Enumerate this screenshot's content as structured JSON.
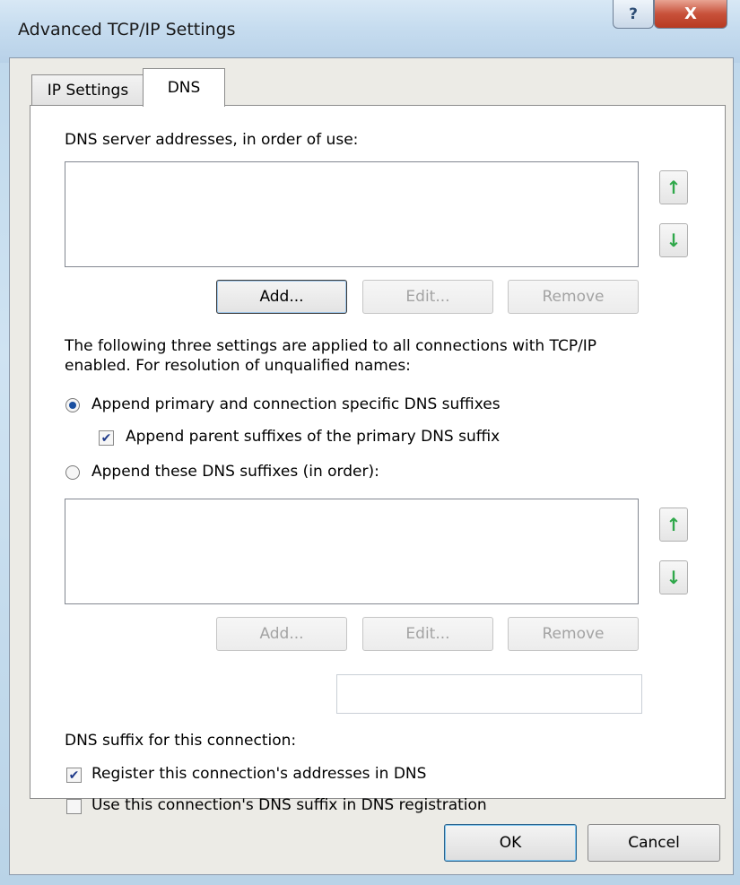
{
  "window": {
    "title": "Advanced TCP/IP Settings",
    "help_label": "?",
    "close_label": "X"
  },
  "tabs": [
    {
      "label": "IP Settings"
    },
    {
      "label": "DNS"
    }
  ],
  "dns_servers": {
    "label": "DNS server addresses, in order of use:",
    "items": [],
    "up_icon": "up-arrow-icon",
    "down_icon": "down-arrow-icon",
    "buttons": {
      "add": "Add...",
      "edit": "Edit...",
      "remove": "Remove"
    }
  },
  "info_text": {
    "line1": "The following three settings are applied to all connections with TCP/IP",
    "line2": "enabled. For resolution of unqualified names:"
  },
  "radio_primary": {
    "label": "Append primary and connection specific DNS suffixes",
    "checked": true
  },
  "check_parent": {
    "label": "Append parent suffixes of the primary DNS suffix",
    "checked": true
  },
  "radio_these": {
    "label": "Append these DNS suffixes (in order):",
    "checked": false
  },
  "dns_suffixes": {
    "items": [],
    "buttons": {
      "add": "Add...",
      "edit": "Edit...",
      "remove": "Remove"
    }
  },
  "suffix_field": {
    "label": "DNS suffix for this connection:",
    "value": ""
  },
  "check_register": {
    "label": "Register this connection's addresses in DNS",
    "checked": true
  },
  "check_use_suffix": {
    "label": "Use this connection's DNS suffix in DNS registration",
    "checked": false
  },
  "footer": {
    "ok": "OK",
    "cancel": "Cancel"
  },
  "colors": {
    "accent": "#1a4fa0",
    "arrow": "#2fa84a",
    "close": "#c8513a"
  }
}
